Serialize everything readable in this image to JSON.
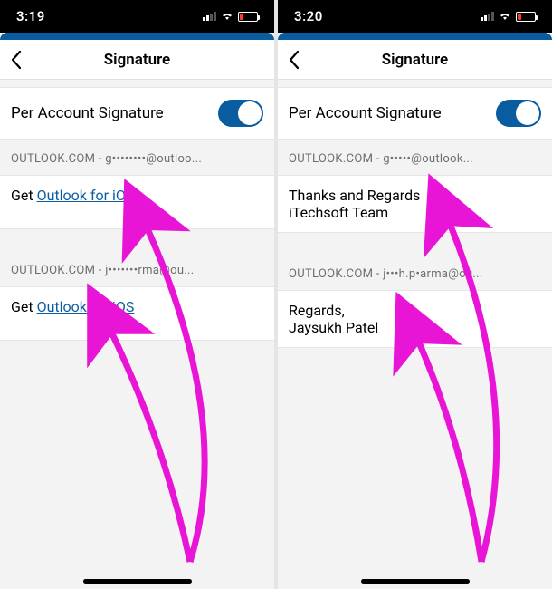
{
  "left": {
    "status_time": "3:19",
    "nav_title": "Signature",
    "toggle_label": "Per Account Signature",
    "toggle_on": true,
    "accounts": [
      {
        "header": "OUTLOOK.COM - g••••••••@outloo...",
        "sig_prefix": "Get ",
        "sig_link": "Outlook for iOS",
        "lines": []
      },
      {
        "header": "OUTLOOK.COM - j•••••••rma@ou...",
        "sig_prefix": "Get ",
        "sig_link": "Outlook for iOS",
        "lines": []
      }
    ]
  },
  "right": {
    "status_time": "3:20",
    "nav_title": "Signature",
    "toggle_label": "Per Account Signature",
    "toggle_on": true,
    "accounts": [
      {
        "header": "OUTLOOK.COM - g•••••@outlook...",
        "sig_prefix": "",
        "sig_link": "",
        "lines": [
          "Thanks and Regards",
          "iTechsoft Team"
        ]
      },
      {
        "header": "OUTLOOK.COM - j•••h.p•arma@ou...",
        "sig_prefix": "",
        "sig_link": "",
        "lines": [
          "Regards,",
          "Jaysukh Patel"
        ]
      }
    ]
  }
}
